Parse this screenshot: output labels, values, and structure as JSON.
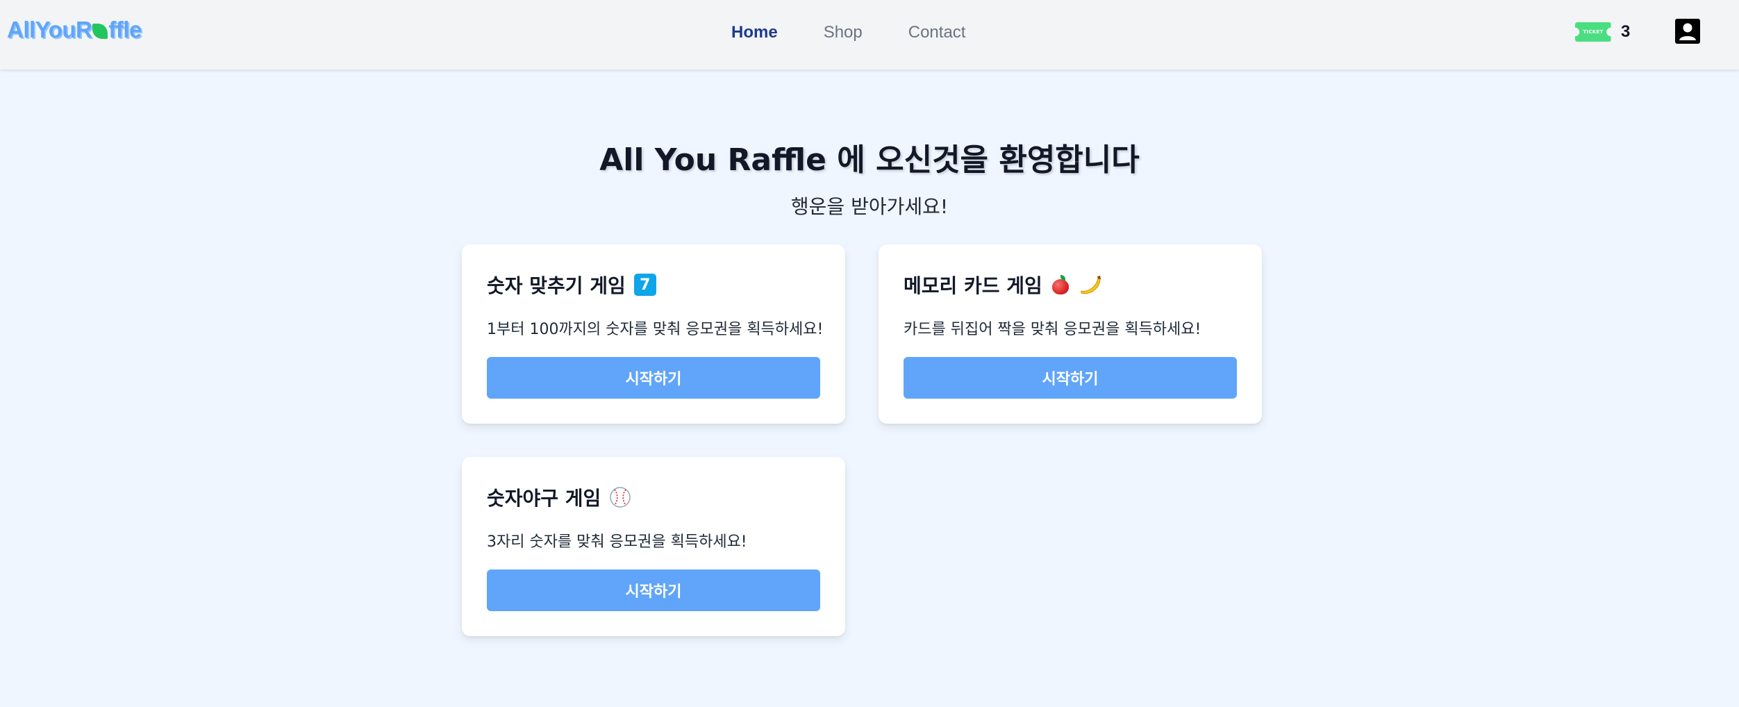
{
  "brand": {
    "logo_text_a": "AllYouR",
    "logo_text_b": "ffle"
  },
  "nav": {
    "links": [
      {
        "label": "Home",
        "active": true
      },
      {
        "label": "Shop",
        "active": false
      },
      {
        "label": "Contact",
        "active": false
      }
    ]
  },
  "header": {
    "ticket_label": "TICKET",
    "ticket_count": "3",
    "ticket_icon": "ticket-icon",
    "user_icon": "user-profile-icon"
  },
  "hero": {
    "title": "All You Raffle 에 오신것을 환영합니다",
    "subtitle": "행운을 받아가세요!"
  },
  "games": [
    {
      "title": "숫자 맞추기 게임",
      "emoji": "keycap-7",
      "emoji_text": "7",
      "description": "1부터 100까지의 숫자를 맞춰 응모권을 획득하세요!",
      "button_label": "시작하기"
    },
    {
      "title": "메모리 카드 게임",
      "emoji": "apple-banana",
      "description": "카드를 뒤집어 짝을 맞춰 응모권을 획득하세요!",
      "button_label": "시작하기"
    },
    {
      "title": "숫자야구 게임",
      "emoji": "baseball",
      "description": "3자리 숫자를 맞춰 응모권을 획득하세요!",
      "button_label": "시작하기"
    }
  ],
  "colors": {
    "page_bg": "#eff6ff",
    "nav_bg": "#f3f4f6",
    "accent": "#60a5fa",
    "nav_active": "#1e3a8a",
    "ticket": "#4ade80"
  }
}
